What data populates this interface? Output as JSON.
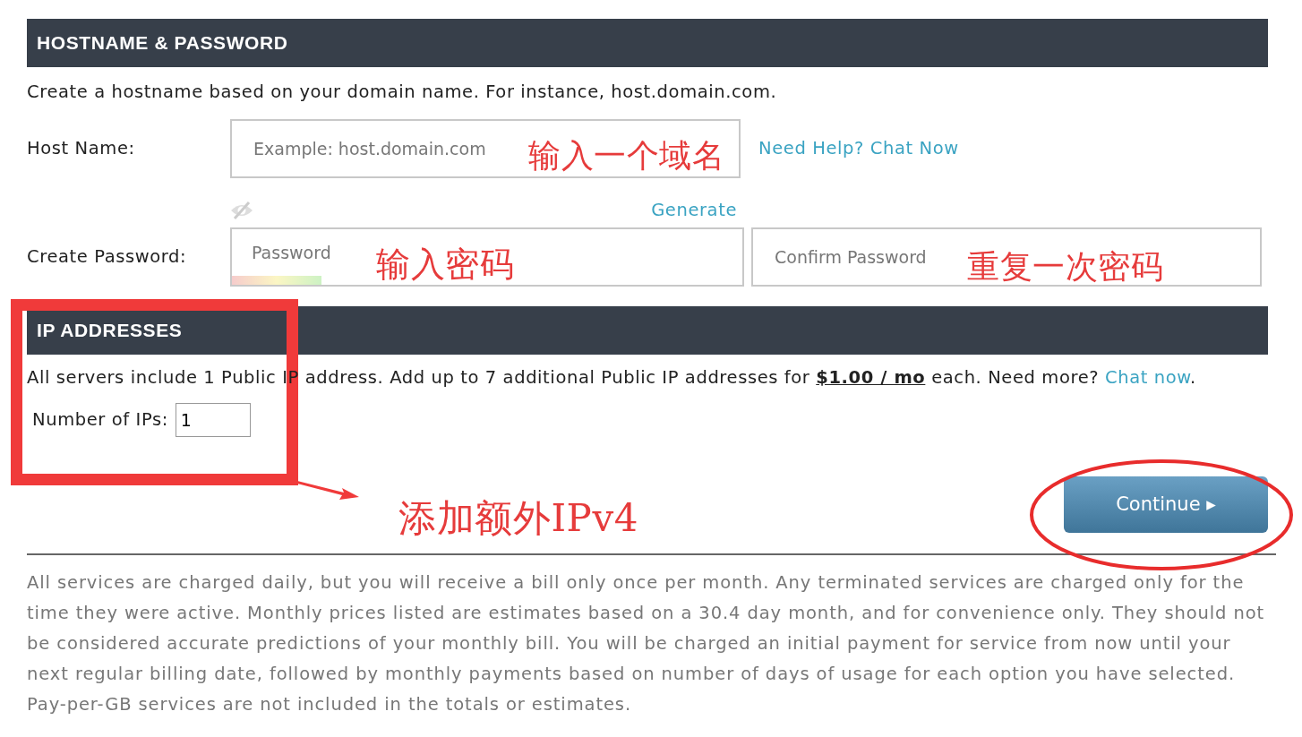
{
  "hostname_section": {
    "title": "HOSTNAME & PASSWORD",
    "description": "Create a hostname based on your domain name. For instance, host.domain.com.",
    "host_name": {
      "label": "Host Name:",
      "placeholder": "Example: host.domain.com"
    },
    "help_link": "Need Help? Chat Now",
    "generate_link": "Generate",
    "password": {
      "label": "Create Password:",
      "placeholder": "Password"
    },
    "confirm_password": {
      "placeholder": "Confirm Password"
    }
  },
  "ip_section": {
    "title": "IP ADDRESSES",
    "description": "All servers include 1 Public IP address. Add up to 7 additional Public IP addresses for **$1.00 / mo** each. Need more?",
    "chat_link": "Chat now",
    "trailing": ".",
    "number_of_ips": {
      "label": "Number of IPs:",
      "value": "1"
    }
  },
  "continue_button": "Continue ▸",
  "footer_note": "All services are charged daily, but you will receive a bill only once per month. Any terminated services are charged only for the time they were active. Monthly prices listed are estimates based on a 30.4 day month, and for convenience only. They should not be considered accurate predictions of your monthly bill. You will be charged an initial payment for service from now until your next regular billing date, followed by monthly payments based on number of days of usage for each option you have selected. Pay-per-GB services are not included in the totals or estimates.",
  "annotations": [
    {
      "kind": "text",
      "text": "输入一个域名"
    },
    {
      "kind": "text",
      "text": "输入密码"
    },
    {
      "kind": "text",
      "text": "重复一次密码"
    },
    {
      "kind": "text",
      "text": "添加额外IPv4"
    },
    {
      "kind": "box"
    },
    {
      "kind": "arrow"
    },
    {
      "kind": "ellipse"
    }
  ]
}
